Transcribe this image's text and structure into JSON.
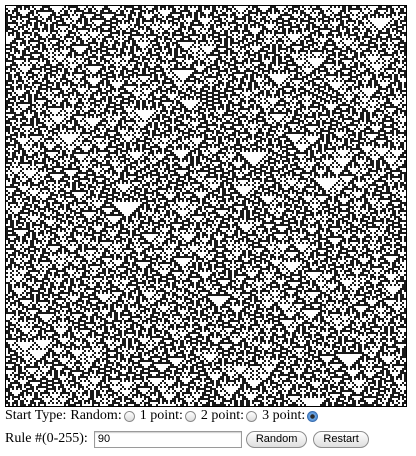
{
  "automaton": {
    "rule": 90,
    "start_type": "3 point"
  },
  "controls": {
    "start_type_label": "Start Type:",
    "options": [
      {
        "label": "Random:",
        "checked": false
      },
      {
        "label": "1 point:",
        "checked": false
      },
      {
        "label": "2 point:",
        "checked": false
      },
      {
        "label": "3 point:",
        "checked": true
      }
    ],
    "rule_label": "Rule #(0-255):",
    "rule_value": "90",
    "random_button": "Random",
    "restart_button": "Restart"
  },
  "colors": {
    "cell_on": "#1a1a1a",
    "cell_off": "#ffffff",
    "radio_selected": "#3b78c4"
  }
}
